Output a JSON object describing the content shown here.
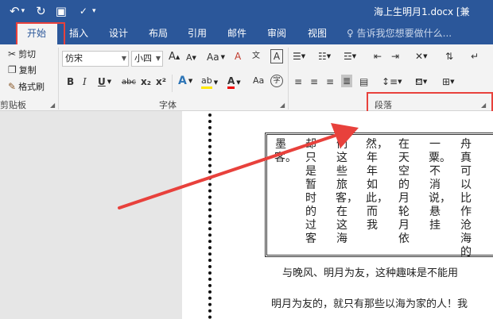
{
  "titlebar": {
    "undo_icon": "undo-icon",
    "redo_icon": "redo-icon",
    "doc_title": "海上生明月1.docx [兼"
  },
  "tabs": [
    {
      "label": "开始",
      "active": true
    },
    {
      "label": "插入"
    },
    {
      "label": "设计"
    },
    {
      "label": "布局"
    },
    {
      "label": "引用"
    },
    {
      "label": "邮件"
    },
    {
      "label": "审阅"
    },
    {
      "label": "视图"
    }
  ],
  "tell_me": "告诉我您想要做什么...",
  "clipboard": {
    "cut": "剪切",
    "copy": "复制",
    "format_painter": "格式刷",
    "group_label": "剪贴板"
  },
  "font": {
    "name": "仿宋",
    "size": "小四",
    "grow": "A",
    "shrink": "A",
    "case": "Aa",
    "clear": "A",
    "border": "A",
    "bold": "B",
    "italic": "I",
    "underline": "U",
    "strike": "abc",
    "subscript": "x₂",
    "superscript": "x²",
    "effects": "A",
    "highlight": "ab",
    "color": "A",
    "phonetic": "Aa",
    "enclose": "字",
    "group_label": "字体"
  },
  "paragraph": {
    "group_label": "段落"
  },
  "document": {
    "columns": [
      "墨客。",
      "却只是暂时的过客",
      "们这些旅客，在这海",
      "然，年年如此，而我",
      "在天空的月轮月依",
      "一粟。不消说，悬挂",
      "舟真可以比作沧海的"
    ],
    "line1": "与晚风、明月为友，这种趣味是不能用",
    "line2": "明月为友的，就只有那些以海为家的人！我"
  },
  "colors": {
    "accent": "#2b579a",
    "annotation": "#e8413c"
  }
}
